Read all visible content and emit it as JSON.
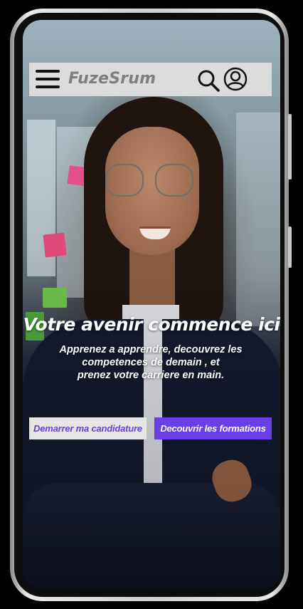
{
  "header": {
    "brand": "FuzeSrum",
    "menu_icon": "hamburger-menu-icon",
    "search_icon": "search-icon",
    "account_icon": "user-account-icon"
  },
  "hero": {
    "title": "Votre avenir commence ici",
    "subtitle_line1": "Apprenez a apprendre, decouvrez les",
    "subtitle_line2": "competences de demain , et",
    "subtitle_line3": "prenez votre carriere en main."
  },
  "actions": {
    "primary_label": "Demarrer ma candidature",
    "secondary_label": "Decouvrir les formations"
  },
  "colors": {
    "accent": "#6a3fe8",
    "header_bg": "#dcdcdc",
    "brand_text": "#7e7e7e"
  }
}
